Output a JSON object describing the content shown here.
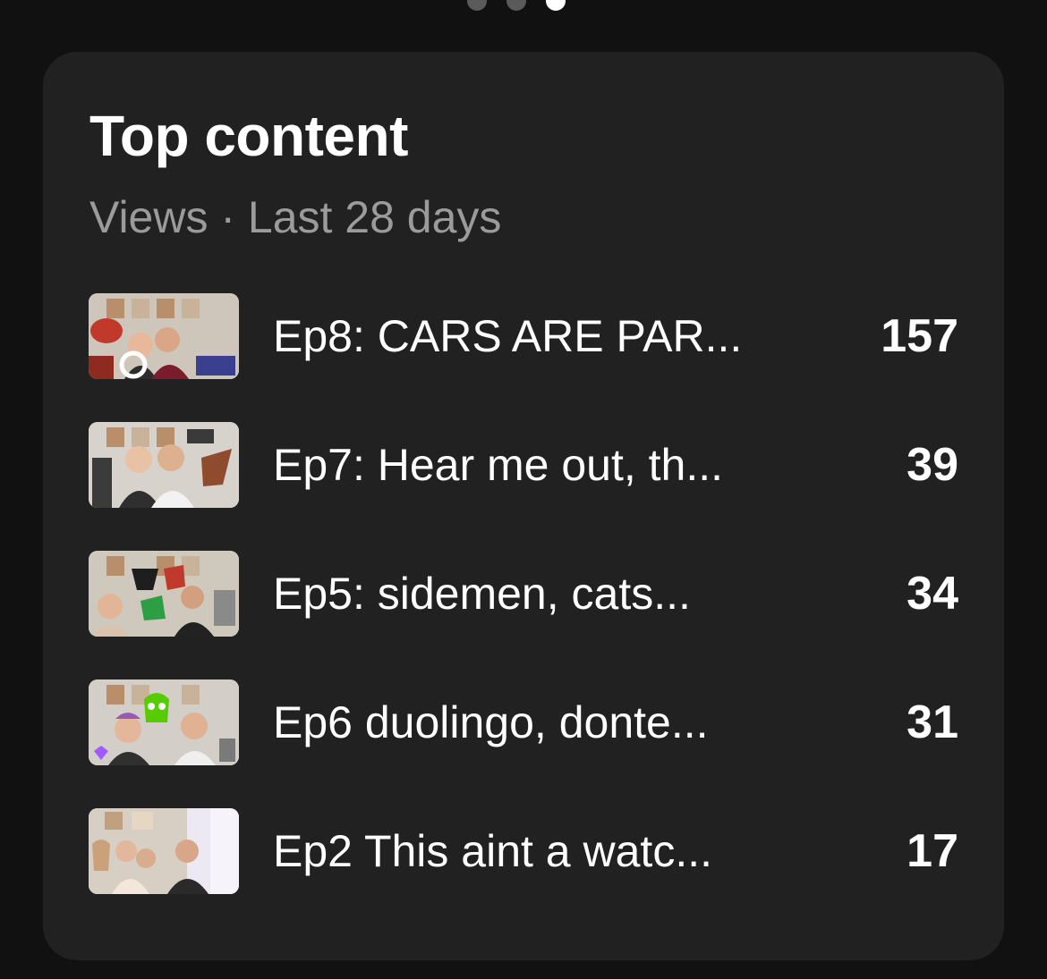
{
  "pager": {
    "pages": 3,
    "active_index": 2
  },
  "card": {
    "title": "Top content",
    "subtitle": "Views · Last 28 days"
  },
  "items": [
    {
      "title": "Ep8: CARS ARE PAR...",
      "views": "157",
      "thumb_colors": {
        "bg": "#cfc6bb",
        "accent": "#c0392b",
        "person": "#e8b89a"
      }
    },
    {
      "title": "Ep7: Hear me out, th...",
      "views": "39",
      "thumb_colors": {
        "bg": "#d7d3cc",
        "accent": "#8e4b2e",
        "person": "#e9c1a4"
      }
    },
    {
      "title": "Ep5: sidemen, cats...",
      "views": "34",
      "thumb_colors": {
        "bg": "#cfc8bd",
        "accent": "#c0392b",
        "person": "#e2b596"
      }
    },
    {
      "title": "Ep6  duolingo, donte...",
      "views": "31",
      "thumb_colors": {
        "bg": "#d3cec7",
        "accent": "#58cc02",
        "person": "#e5b79a"
      }
    },
    {
      "title": "Ep2  This aint a watc...",
      "views": "17",
      "thumb_colors": {
        "bg": "#ece9f2",
        "accent": "#c9a27a",
        "person": "#e3b79b"
      }
    }
  ]
}
